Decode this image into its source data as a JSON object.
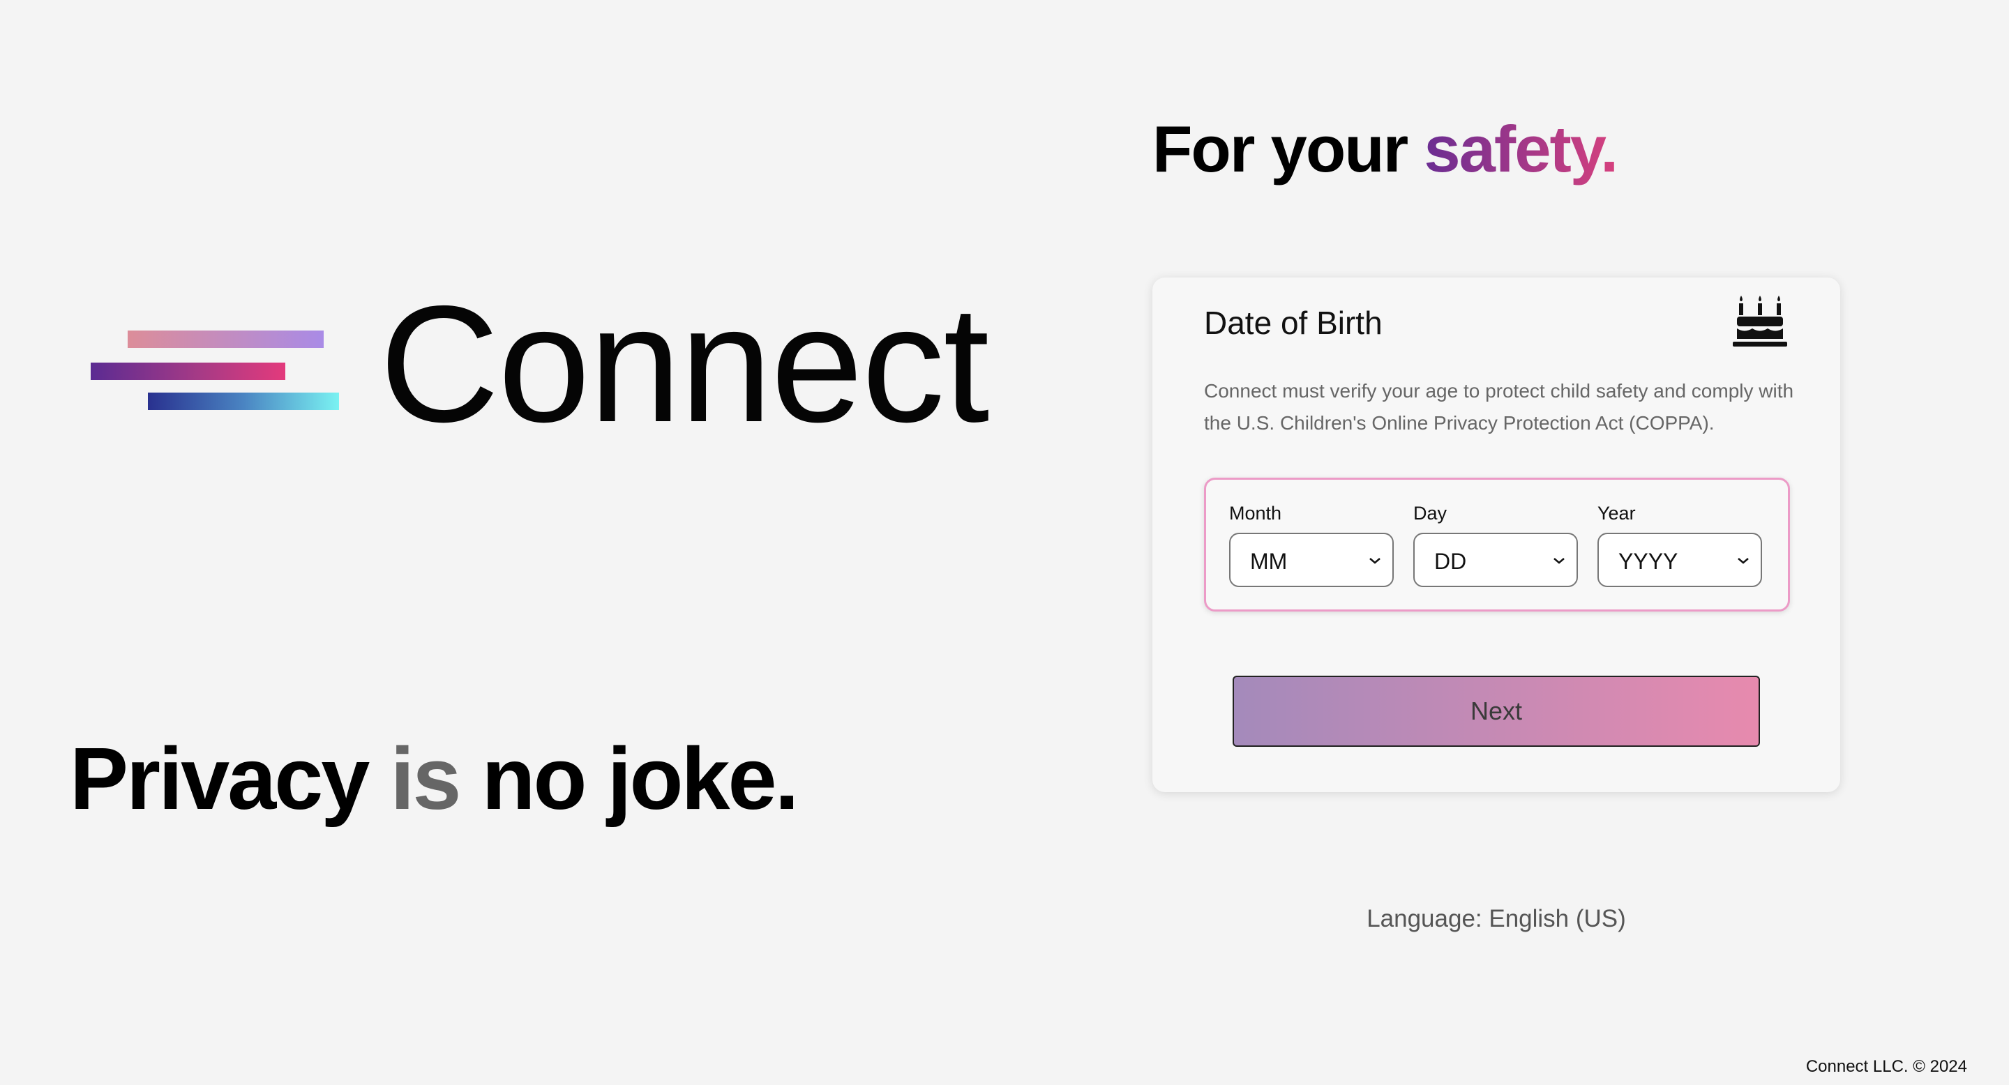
{
  "brand": {
    "name": "Connect",
    "tagline_part1": "Privacy",
    "tagline_part2": "is",
    "tagline_part3": "no joke."
  },
  "headline": {
    "text": "For your ",
    "accent": "safety."
  },
  "dob_card": {
    "title": "Date of Birth",
    "icon": "birthday-cake-icon",
    "description": "Connect must verify your age to protect child safety and comply with the U.S. Children's Online Privacy Protection Act (COPPA).",
    "fields": {
      "month": {
        "label": "Month",
        "value": "MM"
      },
      "day": {
        "label": "Day",
        "value": "DD"
      },
      "year": {
        "label": "Year",
        "value": "YYYY"
      }
    },
    "next_label": "Next"
  },
  "language": "Language: English (US)",
  "footer": "Connect LLC. © 2024",
  "colors": {
    "background": "#f4f4f4",
    "accent_start": "#6a2d92",
    "accent_end": "#d6417e",
    "button_start": "#a48abb",
    "button_end": "#e78aae",
    "dob_border": "#ec9bc7"
  }
}
